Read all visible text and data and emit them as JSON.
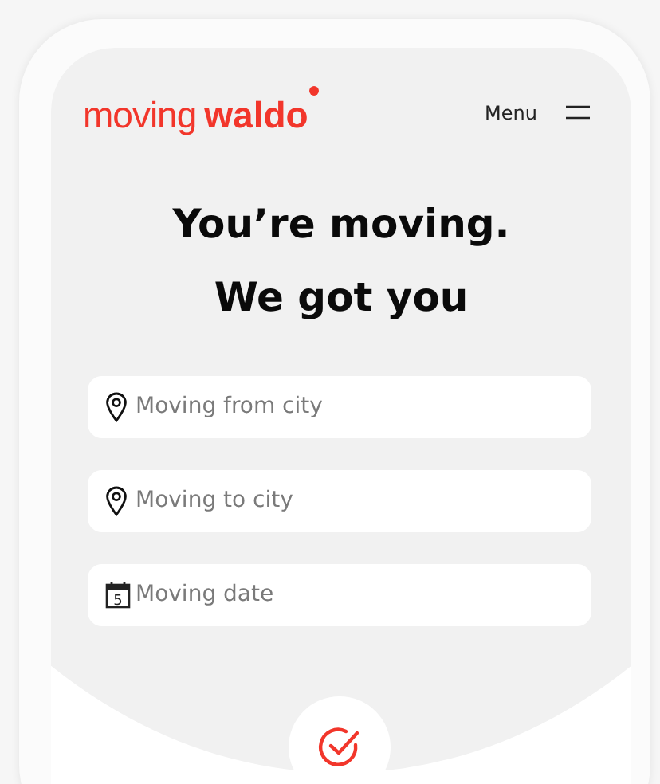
{
  "header": {
    "logo": {
      "light": "moving",
      "bold": "waldo"
    },
    "menu_label": "Menu"
  },
  "headline": [
    "You’re moving.",
    "We got you"
  ],
  "fields": [
    {
      "kind": "location",
      "placeholder": "Moving from city"
    },
    {
      "kind": "location",
      "placeholder": "Moving to city"
    },
    {
      "kind": "date",
      "placeholder": "Moving date",
      "icon_text": "5"
    }
  ]
}
